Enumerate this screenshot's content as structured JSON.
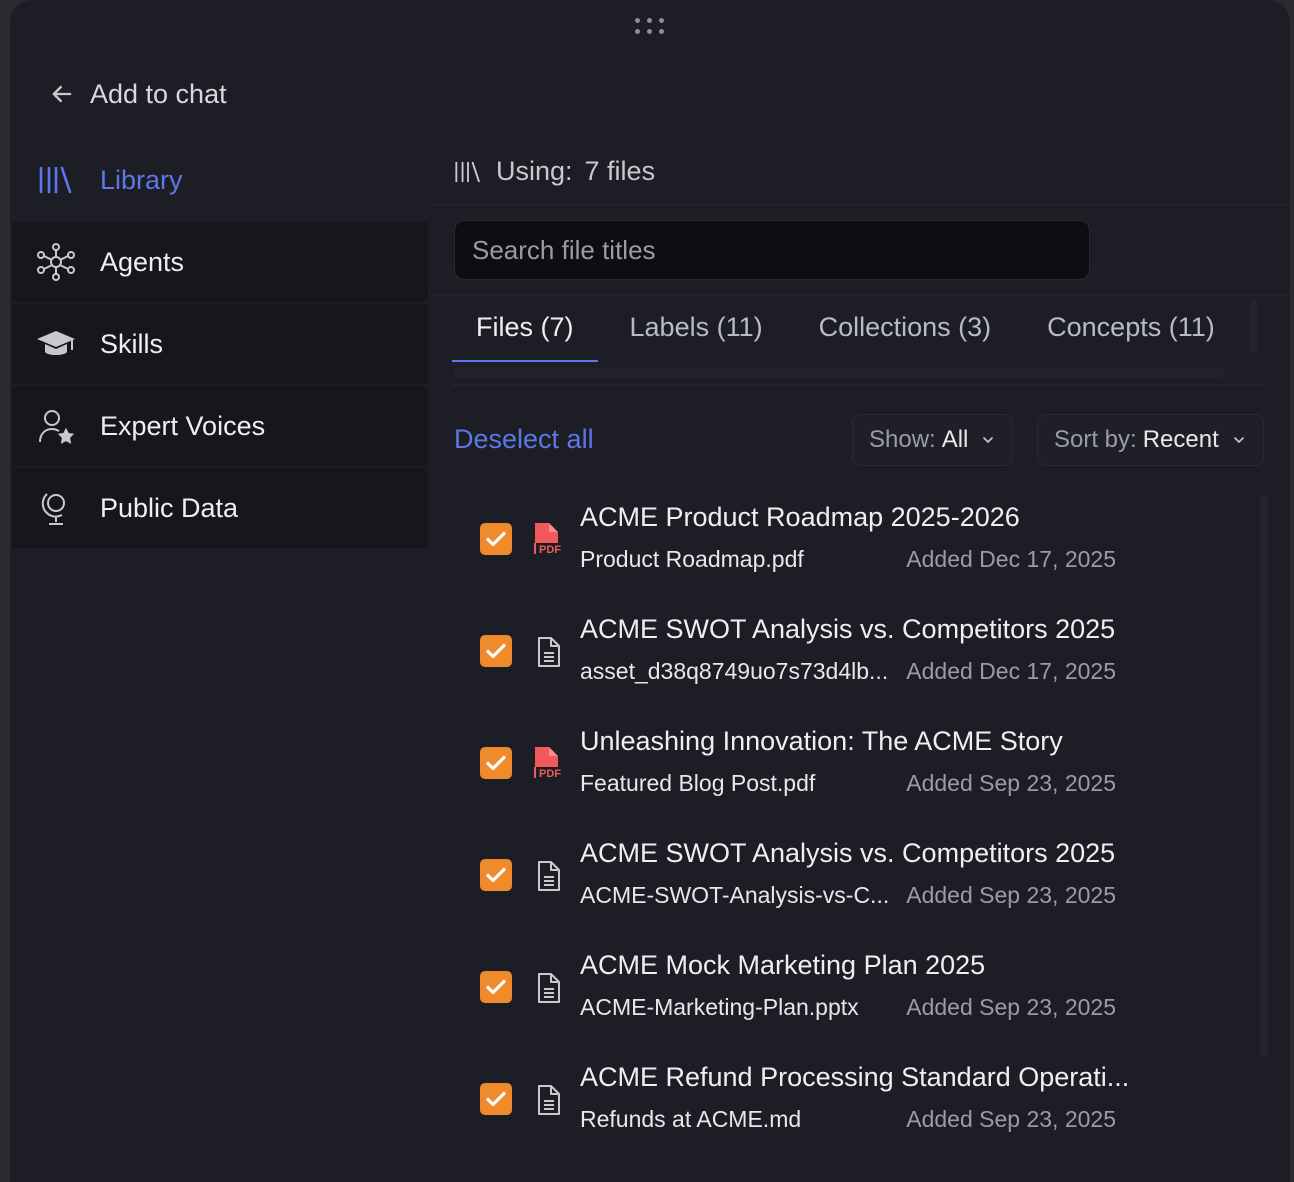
{
  "header": {
    "title": "Add to chat"
  },
  "sidebar": {
    "items": [
      {
        "label": "Library",
        "icon": "library-icon",
        "active": true
      },
      {
        "label": "Agents",
        "icon": "network-icon"
      },
      {
        "label": "Skills",
        "icon": "graduation-cap-icon"
      },
      {
        "label": "Expert Voices",
        "icon": "person-star-icon"
      },
      {
        "label": "Public Data",
        "icon": "globe-stand-icon"
      }
    ]
  },
  "content": {
    "using_label": "Using:",
    "using_value": "7 files",
    "search_placeholder": "Search file titles",
    "tabs": [
      "Files (7)",
      "Labels (11)",
      "Collections (3)",
      "Concepts (11)"
    ],
    "deselect_label": "Deselect all",
    "show": {
      "label": "Show:",
      "value": "All"
    },
    "sort": {
      "label": "Sort by:",
      "value": "Recent"
    },
    "files": [
      {
        "title": "ACME Product Roadmap 2025-2026",
        "filename": "Product Roadmap.pdf",
        "added": "Added Dec 17, 2025",
        "type": "pdf",
        "checked": true
      },
      {
        "title": "ACME SWOT Analysis vs. Competitors 2025",
        "filename": "asset_d38q8749uo7s73d4lb...",
        "added": "Added Dec 17, 2025",
        "type": "doc",
        "checked": true
      },
      {
        "title": "Unleashing Innovation: The ACME Story",
        "filename": "Featured Blog Post.pdf",
        "added": "Added Sep 23, 2025",
        "type": "pdf",
        "checked": true
      },
      {
        "title": "ACME SWOT Analysis vs. Competitors 2025",
        "filename": "ACME-SWOT-Analysis-vs-C...",
        "added": "Added Sep 23, 2025",
        "type": "doc",
        "checked": true
      },
      {
        "title": "ACME Mock Marketing Plan 2025",
        "filename": "ACME-Marketing-Plan.pptx",
        "added": "Added Sep 23, 2025",
        "type": "doc",
        "checked": true
      },
      {
        "title": "ACME Refund Processing Standard Operati...",
        "filename": "Refunds at ACME.md",
        "added": "Added Sep 23, 2025",
        "type": "doc",
        "checked": true
      }
    ]
  },
  "colors": {
    "accent": "#5b78e6",
    "checkbox": "#ef8b2c",
    "pdf": "#f15a5a",
    "background": "#1d1e25"
  }
}
